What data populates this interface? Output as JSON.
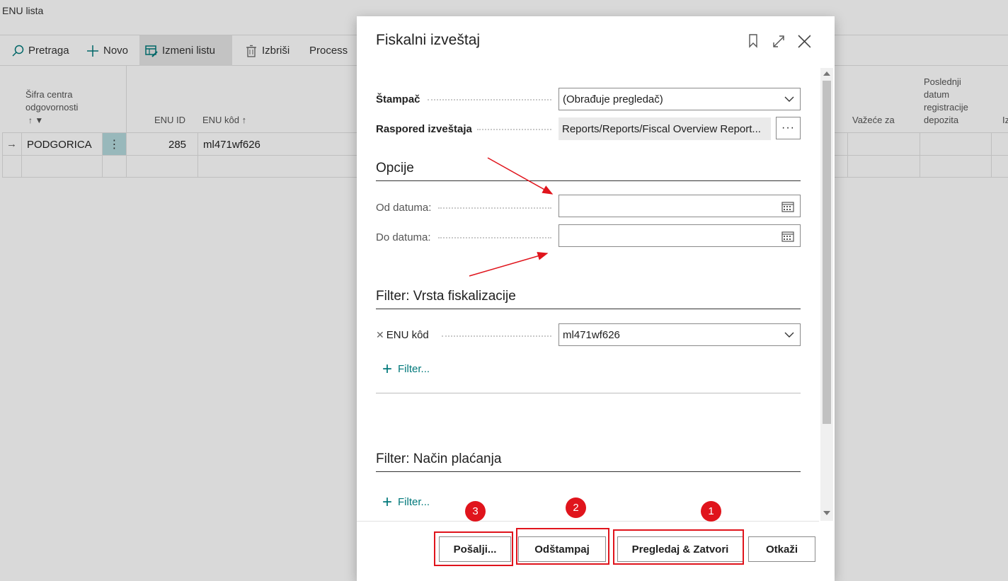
{
  "page": {
    "title": "ENU lista"
  },
  "toolbar": {
    "search_label": "Pretraga",
    "new_label": "Novo",
    "edit_list_label": "Izmeni listu",
    "delete_label": "Izbriši",
    "process_label": "Process"
  },
  "grid": {
    "headers": {
      "responsibility_center": "Šifra centra odgovornosti",
      "enu_id": "ENU ID",
      "enu_code": "ENU kôd",
      "valid_for": "Važeće za",
      "last_deposit_date": "Poslednji datum registracije depozita",
      "partial_col": "Iz"
    },
    "rows": [
      {
        "responsibility_center": "PODGORICA",
        "enu_id": "285",
        "enu_code": "ml471wf626"
      }
    ]
  },
  "dialog": {
    "title": "Fiskalni izveštaj",
    "printer_label": "Štampač",
    "printer_value": "(Obrađuje pregledač)",
    "layout_label": "Raspored izveštaja",
    "layout_value": "Reports/Reports/Fiscal Overview Report...",
    "layout_assist": "···",
    "options_section": "Opcije",
    "from_date_label": "Od datuma:",
    "from_date_value": "",
    "to_date_label": "Do datuma:",
    "to_date_value": "",
    "filter_fiscal_section": "Filter: Vrsta fiskalizacije",
    "enu_code_filter_label": "ENU kôd",
    "enu_code_filter_value": "ml471wf626",
    "add_filter_label": "Filter...",
    "filter_payment_section": "Filter: Način plaćanja",
    "add_filter_label_2": "Filter...",
    "buttons": {
      "send": "Pošalji...",
      "print": "Odštampaj",
      "preview_close": "Pregledaj & Zatvori",
      "cancel": "Otkaži"
    }
  },
  "annotations": {
    "badge_1": "1",
    "badge_2": "2",
    "badge_3": "3",
    "highlight_color": "#e0141c"
  },
  "colors": {
    "accent": "#00787a",
    "row_action_bg": "#b3d9dc"
  }
}
